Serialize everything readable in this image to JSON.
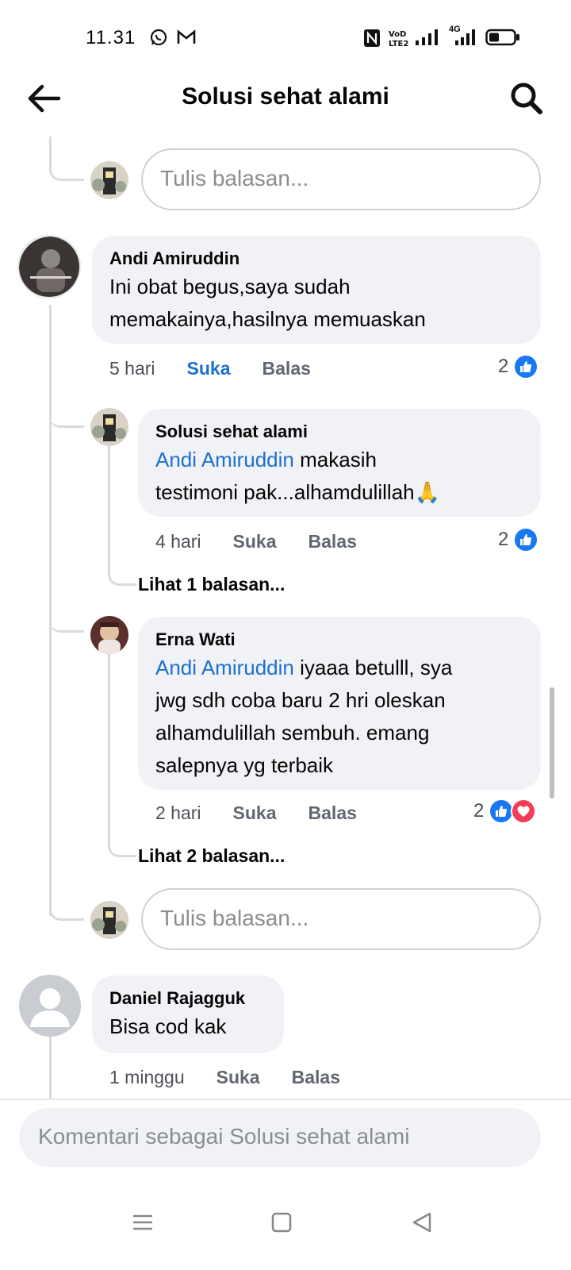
{
  "status_bar": {
    "time": "11.31",
    "network_label": "4G"
  },
  "app_bar": {
    "title": "Solusi sehat alami"
  },
  "reply_placeholder": "Tulis balasan...",
  "comments": [
    {
      "name": "Andi Amiruddin",
      "text_line1": "Ini obat begus,saya sudah",
      "text_line2": "memakainya,hasilnya memuaskan",
      "time": "5 hari",
      "like_label": "Suka",
      "reply_label": "Balas",
      "reaction_count": "2",
      "replies": [
        {
          "name": "Solusi sehat alami",
          "mention": "Andi Amiruddin",
          "text_line1": " makasih",
          "text_line2": "testimoni pak...alhamdulillah🙏",
          "time": "4 hari",
          "like_label": "Suka",
          "reply_label": "Balas",
          "reaction_count": "2",
          "view_replies": "Lihat 1 balasan..."
        },
        {
          "name": "Erna Wati",
          "mention": "Andi Amiruddin",
          "text_line1": " iyaaa betulll, sya",
          "text_line2": "jwg sdh coba baru 2 hri oleskan",
          "text_line3": "alhamdulillah sembuh. emang",
          "text_line4": "salepnya yg terbaik",
          "time": "2 hari",
          "like_label": "Suka",
          "reply_label": "Balas",
          "reaction_count": "2",
          "view_replies": "Lihat 2 balasan..."
        }
      ]
    },
    {
      "name": "Daniel Rajagguk",
      "text_line1": "Bisa cod kak",
      "time": "1 minggu",
      "like_label": "Suka",
      "reply_label": "Balas"
    }
  ],
  "comment_input": {
    "placeholder": "Komentari sebagai Solusi sehat alami"
  },
  "colors": {
    "link_blue": "#1d6fd0",
    "like_blue": "#1877f2",
    "love_red": "#f33e58",
    "bubble_bg": "#f0f2f5"
  }
}
